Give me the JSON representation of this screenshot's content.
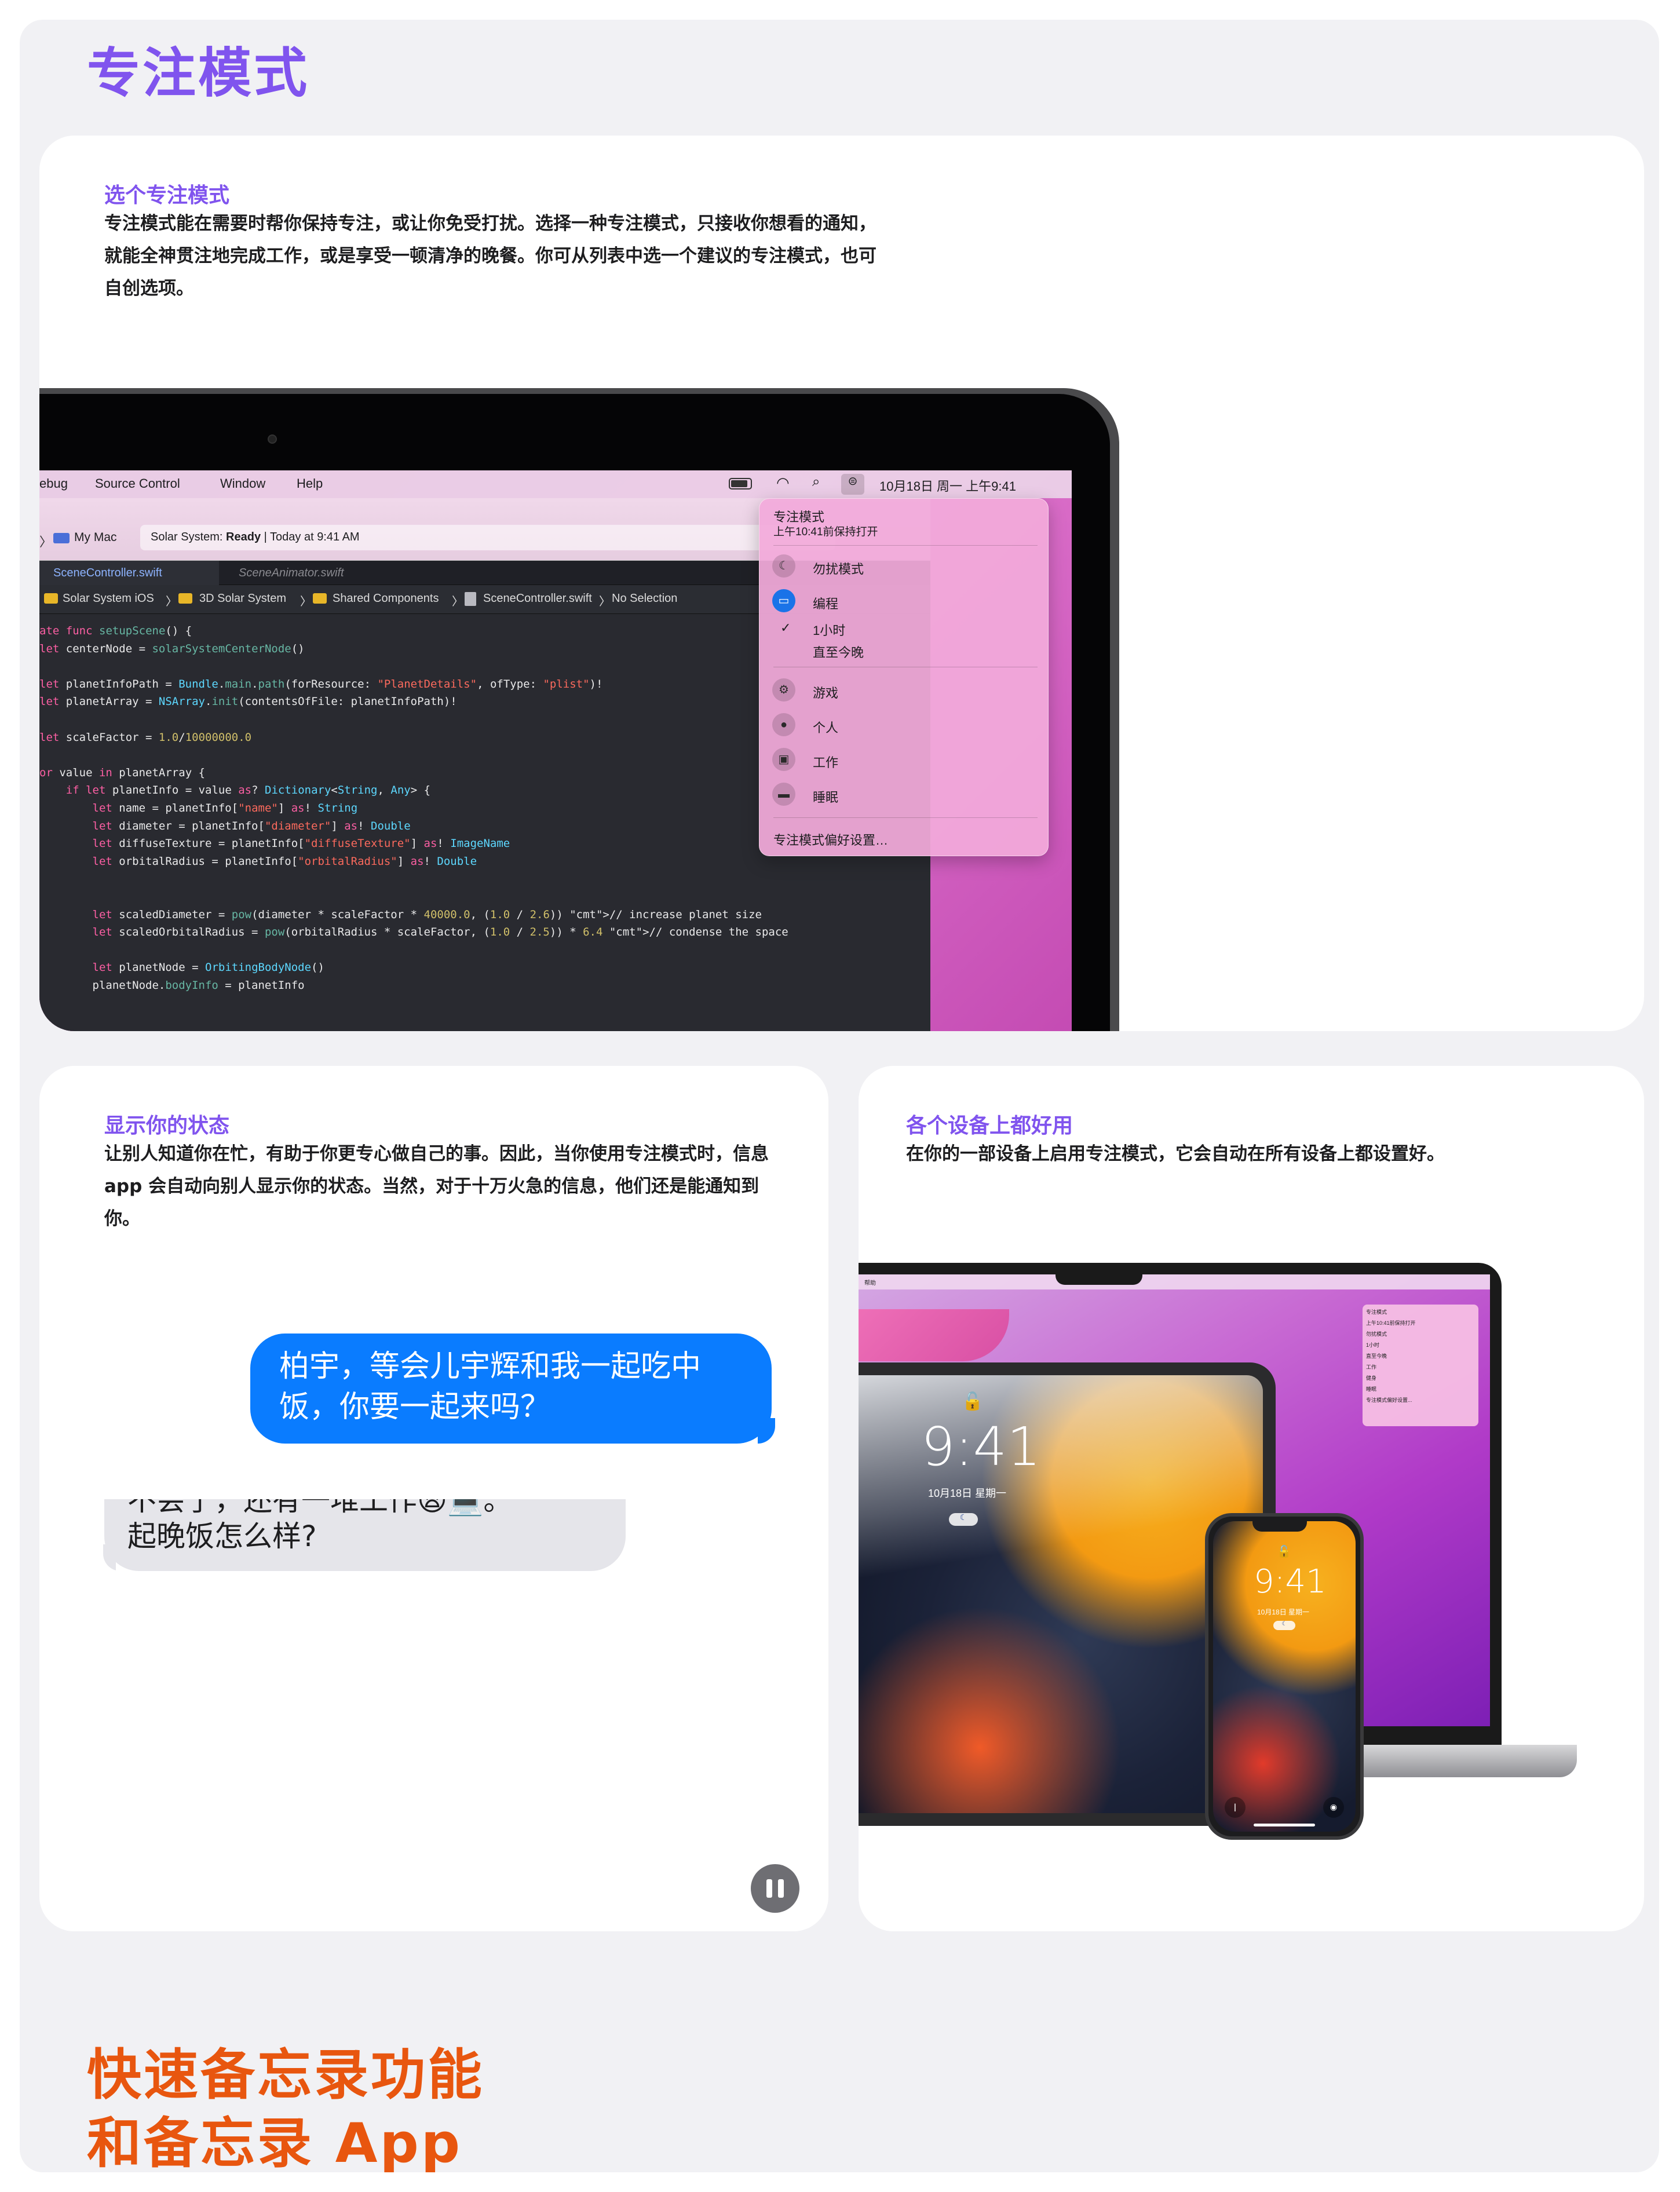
{
  "section_title": "专注模式",
  "card1": {
    "heading": "选个专注模式",
    "body": "专注模式能在需要时帮你保持专注，或让你免受打扰。选择一种专注模式，只接收你想看的通知，就能全神贯注地完成工作，或是享受一顿清净的晚餐。你可从列表中选一个建议的专注模式，也可自创选项。",
    "heading_color": "#8054ee",
    "menubar": {
      "items": [
        "ebug",
        "Source Control",
        "Window",
        "Help"
      ],
      "clock": "10月18日 周一 上午9:41"
    },
    "xcode": {
      "scheme": "My Mac",
      "status_prefix": "Solar System: ",
      "status_ready": "Ready",
      "status_suffix": " | Today at 9:41 AM",
      "tab_active": "SceneController.swift",
      "tab_inactive": "SceneAnimator.swift",
      "path": [
        "Solar System iOS",
        "3D Solar System",
        "Shared Components",
        "SceneController.swift",
        "No Selection"
      ],
      "code_lines": [
        "ate func setupScene() {",
        "let centerNode = solarSystemCenterNode()",
        "",
        "let planetInfoPath = Bundle.main.path(forResource: \"PlanetDetails\", ofType: \"plist\")!",
        "let planetArray = NSArray.init(contentsOfFile: planetInfoPath)!",
        "",
        "let scaleFactor = 1.0/10000000.0",
        "",
        "or value in planetArray {",
        "    if let planetInfo = value as? Dictionary<String, Any> {",
        "        let name = planetInfo[\"name\"] as! String",
        "        let diameter = planetInfo[\"diameter\"] as! Double",
        "        let diffuseTexture = planetInfo[\"diffuseTexture\"] as! ImageName",
        "        let orbitalRadius = planetInfo[\"orbitalRadius\"] as! Double",
        "",
        "",
        "        let scaledDiameter = pow(diameter * scaleFactor * 40000.0, (1.0 / 2.6)) // increase planet size",
        "        let scaledOrbitalRadius = pow(orbitalRadius * scaleFactor, (1.0 / 2.5)) * 6.4 // condense the space",
        "",
        "        let planetNode = OrbitingBodyNode()",
        "        planetNode.bodyInfo = planetInfo"
      ]
    },
    "focus_menu": {
      "title": "专注模式",
      "subtitle": "上午10:41前保持打开",
      "items": [
        {
          "label": "勿扰模式",
          "icon": "moon-icon"
        },
        {
          "label": "编程",
          "icon": "monitor-icon"
        },
        {
          "label": "1小时",
          "icon": "checkmark-icon"
        },
        {
          "label": "直至今晚",
          "icon": ""
        },
        {
          "label": "游戏",
          "icon": "rocket-icon"
        },
        {
          "label": "个人",
          "icon": "person-icon"
        },
        {
          "label": "工作",
          "icon": "badge-icon"
        },
        {
          "label": "睡眠",
          "icon": "bed-icon"
        }
      ],
      "prefs": "专注模式偏好设置…"
    }
  },
  "card2": {
    "heading": "显示你的状态",
    "body": "让别人知道你在忙，有助于你更专心做自己的事。因此，当你使用专注模式时，信息 app 会自动向别人显示你的状态。当然，对于十万火急的信息，他们还是能通知到你。",
    "blue_bubble": "柏宇，等会儿宇辉和我一起吃中饭，你要一起来吗？",
    "grey_bubble_partial": "不会了，还有一堆工作😩💻。",
    "grey_bubble_line2": "起晚饭怎么样?",
    "pause_label": "pause"
  },
  "card3": {
    "heading": "各个设备上都好用",
    "body": "在你的一部设备上启用专注模式，它会自动在所有设备上都设置好。",
    "ipad_time": "9:41",
    "ipad_date": "10月18日 星期一",
    "iphone_time": "9:41",
    "iphone_date": "10月18日 星期一",
    "mini_menu": [
      "专注模式",
      "上午10:41前保持打开",
      "勿扰模式",
      "1小时",
      "直至今晚",
      "工作",
      "健身",
      "睡眠",
      "专注模式偏好设置..."
    ],
    "mbp_menu_left": "帮助"
  },
  "bottom_title_line1": "快速备忘录功能",
  "bottom_title_line2": "和备忘录 App",
  "colors": {
    "accent_purple": "#8054ee",
    "accent_orange": "#e8560f",
    "messages_blue": "#0a7cff"
  }
}
